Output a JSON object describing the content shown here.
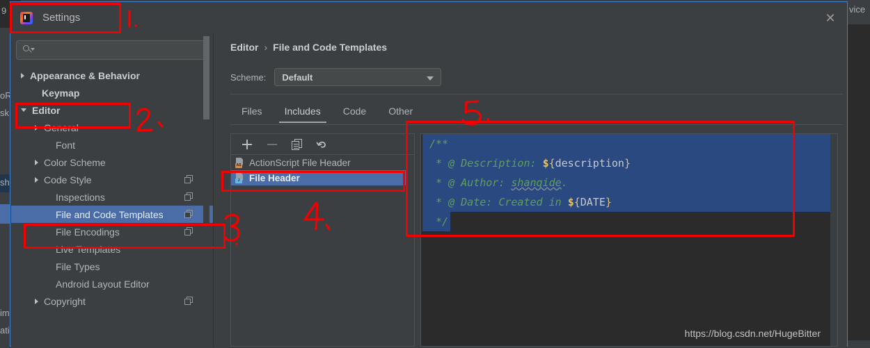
{
  "background": {
    "left_fragments": [
      "oR",
      "sk",
      "sh",
      "im",
      "ati"
    ],
    "right_fragment": "vice",
    "top_left_fragment": "9"
  },
  "dialog": {
    "title": "Settings",
    "icon": "intellij-idea-icon",
    "close_icon": "close-icon"
  },
  "search": {
    "value": "",
    "placeholder": "",
    "icon": "search-icon"
  },
  "tree": {
    "items": [
      {
        "label": "Appearance & Behavior",
        "arrow": "right",
        "indent": 14,
        "bold": true,
        "selected": false,
        "config_icon": false
      },
      {
        "label": "Keymap",
        "arrow": "none",
        "indent": 31,
        "bold": true,
        "selected": false,
        "config_icon": false
      },
      {
        "label": "Editor",
        "arrow": "down",
        "indent": 14,
        "bold": true,
        "selected": false,
        "config_icon": false
      },
      {
        "label": "General",
        "arrow": "right",
        "indent": 34,
        "bold": false,
        "selected": false,
        "config_icon": false
      },
      {
        "label": "Font",
        "arrow": "none",
        "indent": 51,
        "bold": false,
        "selected": false,
        "config_icon": false
      },
      {
        "label": "Color Scheme",
        "arrow": "right",
        "indent": 34,
        "bold": false,
        "selected": false,
        "config_icon": false
      },
      {
        "label": "Code Style",
        "arrow": "right",
        "indent": 34,
        "bold": false,
        "selected": false,
        "config_icon": true
      },
      {
        "label": "Inspections",
        "arrow": "none",
        "indent": 51,
        "bold": false,
        "selected": false,
        "config_icon": true
      },
      {
        "label": "File and Code Templates",
        "arrow": "none",
        "indent": 51,
        "bold": false,
        "selected": true,
        "config_icon": true
      },
      {
        "label": "File Encodings",
        "arrow": "none",
        "indent": 51,
        "bold": false,
        "selected": false,
        "config_icon": true
      },
      {
        "label": "Live Templates",
        "arrow": "none",
        "indent": 51,
        "bold": false,
        "selected": false,
        "config_icon": false
      },
      {
        "label": "File Types",
        "arrow": "none",
        "indent": 51,
        "bold": false,
        "selected": false,
        "config_icon": false
      },
      {
        "label": "Android Layout Editor",
        "arrow": "none",
        "indent": 51,
        "bold": false,
        "selected": false,
        "config_icon": false
      },
      {
        "label": "Copyright",
        "arrow": "right",
        "indent": 34,
        "bold": false,
        "selected": false,
        "config_icon": true
      }
    ]
  },
  "content": {
    "breadcrumb": {
      "root": "Editor",
      "separator": "›",
      "leaf": "File and Code Templates"
    },
    "scheme": {
      "label": "Scheme:",
      "value": "Default",
      "caret_icon": "chevron-down-icon"
    },
    "tabs": [
      {
        "label": "Files",
        "active": false
      },
      {
        "label": "Includes",
        "active": true
      },
      {
        "label": "Code",
        "active": false
      },
      {
        "label": "Other",
        "active": false
      }
    ],
    "list_toolbar": [
      {
        "icon": "plus-icon",
        "name": "add-template-button"
      },
      {
        "icon": "minus-icon",
        "name": "remove-template-button"
      },
      {
        "icon": "copy-icon",
        "name": "copy-template-button"
      },
      {
        "icon": "revert-icon",
        "name": "reset-template-button"
      }
    ],
    "templates": [
      {
        "label": "ActionScript File Header",
        "badge": "AS",
        "selected": false
      },
      {
        "label": "File Header",
        "badge": "J",
        "selected": true
      }
    ]
  },
  "editor": {
    "lines": [
      {
        "selected": true,
        "tokens": [
          {
            "t": "comment",
            "v": "/**"
          }
        ]
      },
      {
        "selected": true,
        "tokens": [
          {
            "t": "comment",
            "v": " * @ Description: "
          },
          {
            "t": "dollar",
            "v": "$"
          },
          {
            "t": "brace",
            "v": "{"
          },
          {
            "t": "var",
            "v": "description"
          },
          {
            "t": "brace",
            "v": "}"
          }
        ]
      },
      {
        "selected": true,
        "tokens": [
          {
            "t": "comment",
            "v": " * @ Author: "
          },
          {
            "t": "comment-wavy",
            "v": "shanqide"
          },
          {
            "t": "comment",
            "v": "."
          }
        ]
      },
      {
        "selected": true,
        "tokens": [
          {
            "t": "comment",
            "v": " * @ Date: Created in "
          },
          {
            "t": "dollar",
            "v": "$"
          },
          {
            "t": "brace",
            "v": "{"
          },
          {
            "t": "var",
            "v": "DATE"
          },
          {
            "t": "brace",
            "v": "}"
          }
        ]
      },
      {
        "selected": false,
        "tokens": [
          {
            "t": "comment",
            "v": " */"
          }
        ],
        "partial_sel": true
      }
    ],
    "raw_text": "/**\n * @ Description: ${description}\n * @ Author: shanqide.\n * @ Date: Created in ${DATE}\n */"
  },
  "watermark": "https://blog.csdn.net/HugeBitter",
  "annotations": [
    {
      "num": "1.",
      "target": "settings-title"
    },
    {
      "num": "2.",
      "target": "editor-tree-node"
    },
    {
      "num": "3.",
      "target": "file-and-code-templates-node"
    },
    {
      "num": "4.",
      "target": "file-header-template-row"
    },
    {
      "num": "5.",
      "target": "template-code-editor"
    }
  ],
  "colors": {
    "accent_blue": "#4a6da7",
    "editor_selection": "#2a4980",
    "annotation_red": "#f50000",
    "dialog_bg": "#3c3f41",
    "editor_bg": "#2b2b2b",
    "comment_green": "#5f9e5f",
    "variable_gold": "#e8c16a"
  }
}
